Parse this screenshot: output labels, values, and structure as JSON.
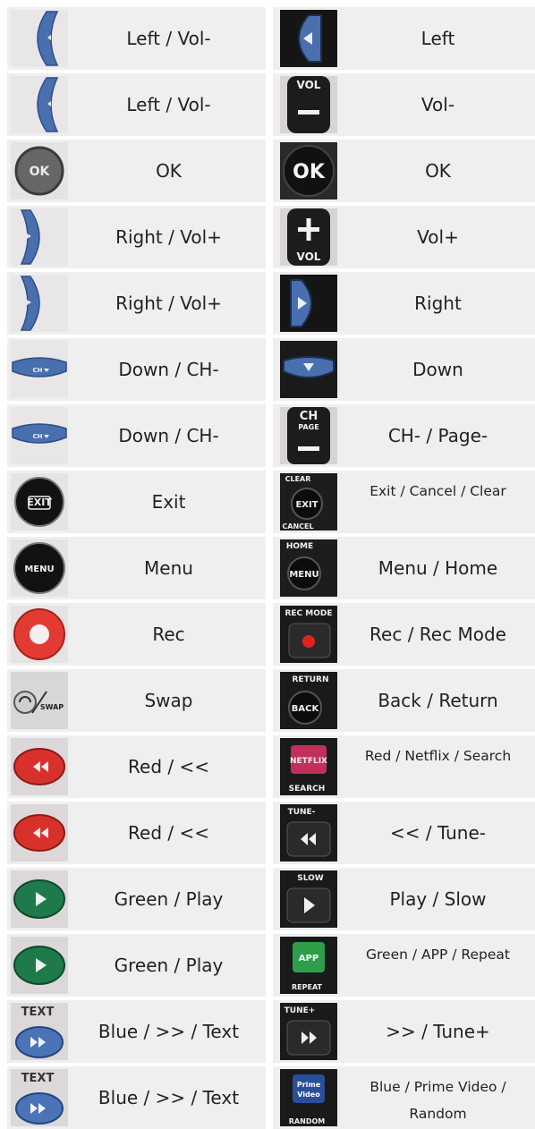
{
  "rows": [
    {
      "left": {
        "label": "Left / Vol-",
        "icon": "vol-left-arrow-icon"
      },
      "right": {
        "label": "Left",
        "icon": "left-arrow-icon"
      }
    },
    {
      "left": {
        "label": "Left / Vol-",
        "icon": "vol-left-arrow-icon"
      },
      "right": {
        "label": "Vol-",
        "icon": "vol-minus-icon",
        "text": "VOL"
      }
    },
    {
      "left": {
        "label": "OK",
        "icon": "ok-button-gray-icon",
        "text": "OK"
      },
      "right": {
        "label": "OK",
        "icon": "ok-button-black-icon",
        "text": "OK"
      }
    },
    {
      "left": {
        "label": "Right / Vol+",
        "icon": "vol-right-arrow-icon"
      },
      "right": {
        "label": "Vol+",
        "icon": "vol-plus-icon",
        "text": "VOL"
      }
    },
    {
      "left": {
        "label": "Right / Vol+",
        "icon": "vol-right-arrow-icon"
      },
      "right": {
        "label": "Right",
        "icon": "right-arrow-icon"
      }
    },
    {
      "left": {
        "label": "Down / CH-",
        "icon": "ch-down-arrow-icon",
        "text": "CH"
      },
      "right": {
        "label": "Down",
        "icon": "down-arrow-icon"
      }
    },
    {
      "left": {
        "label": "Down / CH-",
        "icon": "ch-down-arrow-icon",
        "text": "CH"
      },
      "right": {
        "label": "CH- / Page-",
        "icon": "ch-page-minus-icon",
        "text": "CH",
        "text2": "PAGE"
      }
    },
    {
      "left": {
        "label": "Exit",
        "icon": "exit-button-icon",
        "text": "EXIT"
      },
      "right": {
        "label": "Exit / Cancel / Clear",
        "icon": "exit-clear-cancel-icon",
        "text": "CLEAR",
        "text2": "EXIT",
        "text3": "CANCEL"
      }
    },
    {
      "left": {
        "label": "Menu",
        "icon": "menu-button-icon",
        "text": "MENU"
      },
      "right": {
        "label": "Menu / Home",
        "icon": "menu-home-icon",
        "text": "HOME",
        "text2": "MENU"
      }
    },
    {
      "left": {
        "label": "Rec",
        "icon": "record-button-icon"
      },
      "right": {
        "label": "Rec / Rec Mode",
        "icon": "rec-mode-icon",
        "text": "REC MODE"
      }
    },
    {
      "left": {
        "label": "Swap",
        "icon": "swap-button-icon",
        "text": "SWAP"
      },
      "right": {
        "label": "Back / Return",
        "icon": "back-return-icon",
        "text": "RETURN",
        "text2": "BACK"
      }
    },
    {
      "left": {
        "label": "Red / <<",
        "icon": "red-rewind-icon"
      },
      "right": {
        "label": "Red / Netflix / Search",
        "icon": "netflix-search-icon",
        "text": "NETFLIX",
        "text2": "SEARCH"
      }
    },
    {
      "left": {
        "label": "Red / <<",
        "icon": "red-rewind-icon"
      },
      "right": {
        "label": "<< / Tune-",
        "icon": "tune-minus-rewind-icon",
        "text": "TUNE-"
      }
    },
    {
      "left": {
        "label": "Green / Play",
        "icon": "green-play-icon"
      },
      "right": {
        "label": "Play / Slow",
        "icon": "slow-play-icon",
        "text": "SLOW"
      }
    },
    {
      "left": {
        "label": "Green / Play",
        "icon": "green-play-icon"
      },
      "right": {
        "label": "Green / APP / Repeat",
        "icon": "app-repeat-icon",
        "text": "APP",
        "text2": "REPEAT"
      }
    },
    {
      "left": {
        "label": "Blue / >> / Text",
        "icon": "blue-fastforward-text-icon",
        "text": "TEXT"
      },
      "right": {
        "label": ">> / Tune+",
        "icon": "tune-plus-fastforward-icon",
        "text": "TUNE+"
      }
    },
    {
      "left": {
        "label": "Blue / >> / Text",
        "icon": "blue-fastforward-text-icon",
        "text": "TEXT"
      },
      "right": {
        "label": "Blue / Prime Video / Random",
        "icon": "prime-video-random-icon",
        "text": "Prime",
        "text2": "Video",
        "text3": "RANDOM"
      }
    }
  ],
  "colors": {
    "cell_bg": "#efefef",
    "blue_key": "#4a6fae",
    "red_key": "#d8312c",
    "green_key": "#1e7a4a",
    "black_key": "#141414"
  }
}
